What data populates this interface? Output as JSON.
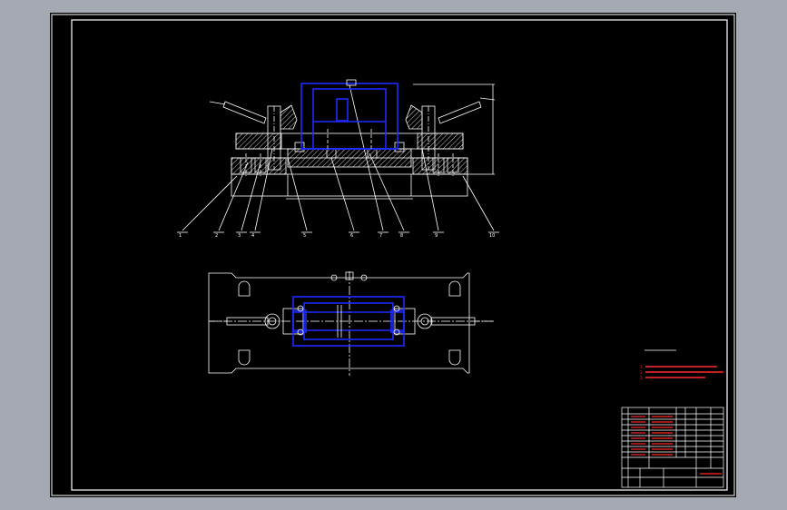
{
  "drawing": {
    "background": "#000000",
    "frame_color": "#ffffff",
    "part_color": "#1f2bff",
    "note_color": "#ff2a2a",
    "hatch_color": "#ffffff"
  },
  "front_view": {
    "balloons": [
      "1",
      "2",
      "3",
      "4",
      "5",
      "6",
      "7",
      "8",
      "9",
      "10"
    ]
  },
  "notes": {
    "items": [
      "1.",
      "2.",
      "3."
    ]
  },
  "title_block": {}
}
